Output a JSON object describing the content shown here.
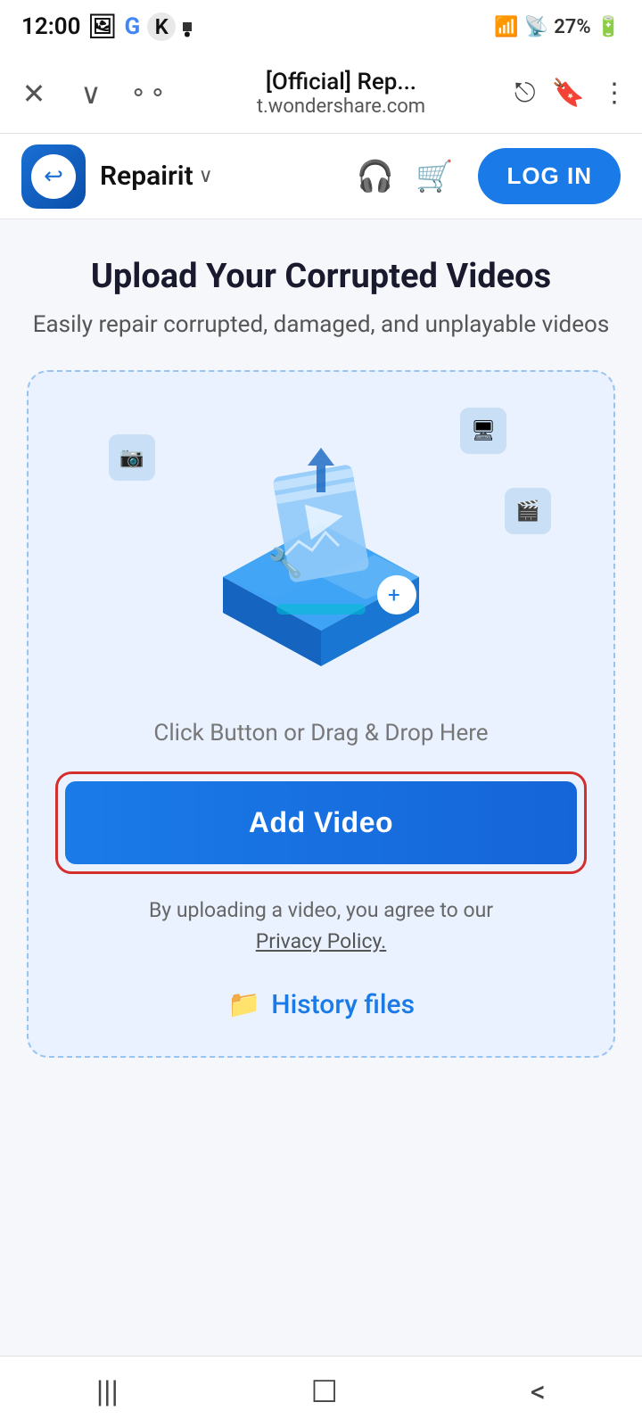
{
  "statusBar": {
    "time": "12:00",
    "batteryPercent": "27%"
  },
  "browserBar": {
    "urlTitle": "[Official] Rep...",
    "urlDomain": "t.wondershare.com"
  },
  "nav": {
    "brandName": "Repairit",
    "loginLabel": "LOG IN"
  },
  "page": {
    "title": "Upload Your Corrupted Videos",
    "subtitle": "Easily repair corrupted, damaged, and unplayable videos",
    "dragDropText": "Click Button or Drag & Drop Here",
    "addVideoLabel": "Add Video",
    "privacyText": "By uploading a video, you agree to our",
    "privacyLinkText": "Privacy Policy.",
    "historyFilesLabel": "History files"
  },
  "bottomNav": {
    "recentIcon": "|||",
    "homeIcon": "☐",
    "backIcon": "<"
  }
}
